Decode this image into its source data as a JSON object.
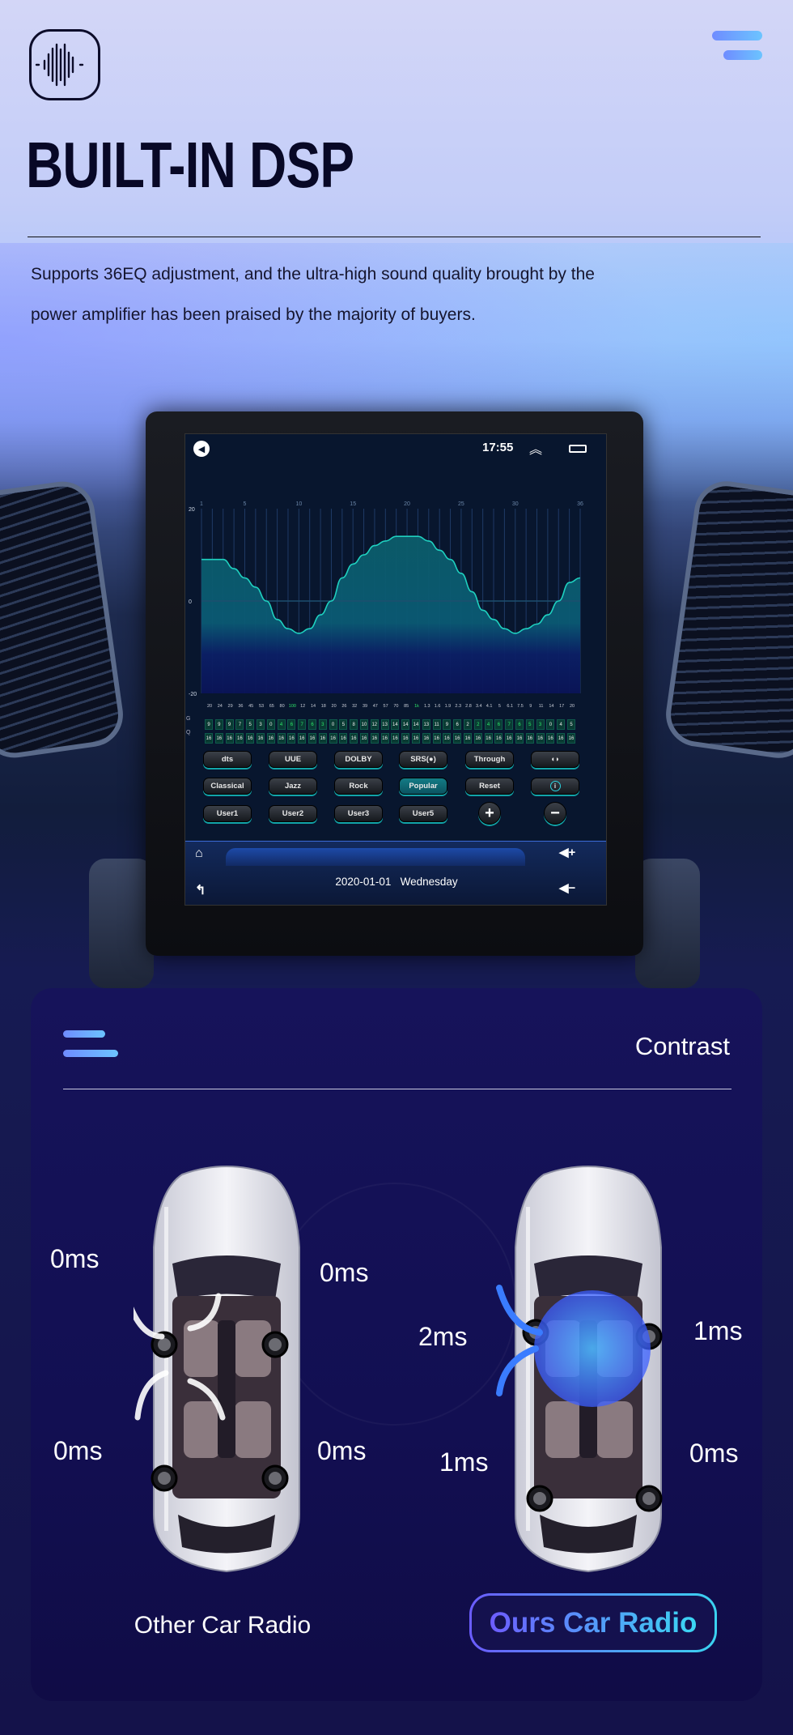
{
  "header": {
    "logo_icon": "sound-wave-icon",
    "menu_icon": "hamburger-menu-icon",
    "title": "BUILT-IN DSP",
    "description_lines": [
      "Supports 36EQ adjustment, and the ultra-high sound quality brought by the",
      "power amplifier has been praised by the majority of buyers."
    ]
  },
  "device": {
    "status_bar": {
      "time": "17:55",
      "left_icon": "speaker-icon",
      "icons": [
        "double-chevron-up-icon",
        "recent-apps-icon"
      ]
    },
    "eq": {
      "row_labels": {
        "gain": "G",
        "q": "Q"
      },
      "frequencies": [
        "20",
        "24",
        "29",
        "36",
        "45",
        "53",
        "65",
        "80",
        "100",
        "12",
        "14",
        "18",
        "20",
        "26",
        "32",
        "39",
        "47",
        "57",
        "70",
        "85",
        "1k",
        "1.3",
        "1.6",
        "1.9",
        "2.3",
        "2.8",
        "3.4",
        "4.1",
        "5",
        "6.1",
        "7.5",
        "9",
        "11",
        "14",
        "17",
        "20"
      ],
      "highlight_frequencies": [
        "100",
        "1k"
      ],
      "q_values": [
        "16",
        "16",
        "16",
        "16",
        "16",
        "16",
        "16",
        "16",
        "16",
        "16",
        "16",
        "16",
        "16",
        "16",
        "16",
        "16",
        "16",
        "16",
        "16",
        "16",
        "16",
        "16",
        "16",
        "16",
        "16",
        "16",
        "16",
        "16",
        "16",
        "16",
        "16",
        "16",
        "16",
        "16",
        "16",
        "16"
      ],
      "colors": {
        "curve": "#1fd1c0",
        "negative_gain": "#2ee86a",
        "button_glow": "#12a4a8"
      }
    },
    "buttons": [
      [
        {
          "label": "dts"
        },
        {
          "label": "UUE"
        },
        {
          "label": "DOLBY"
        },
        {
          "label": "SRS(●)"
        },
        {
          "label": "Through"
        },
        {
          "label": "◖◗",
          "icon": "speaker-balance-icon"
        }
      ],
      [
        {
          "label": "Classical"
        },
        {
          "label": "Jazz"
        },
        {
          "label": "Rock"
        },
        {
          "label": "Popular",
          "active": true
        },
        {
          "label": "Reset"
        },
        {
          "label": "i",
          "icon": "info-icon"
        }
      ],
      [
        {
          "label": "User1"
        },
        {
          "label": "User2"
        },
        {
          "label": "User3"
        },
        {
          "label": "User5"
        },
        {
          "label": "+",
          "icon": "plus-icon"
        },
        {
          "label": "−",
          "icon": "minus-icon"
        }
      ]
    ],
    "bottom_bar": {
      "date": "2020-01-01",
      "weekday": "Wednesday",
      "icons": [
        "home-icon",
        "back-icon",
        "volume-up-icon",
        "volume-down-icon"
      ]
    }
  },
  "chart_data": {
    "type": "area",
    "x": [
      1,
      2,
      3,
      4,
      5,
      6,
      7,
      8,
      9,
      10,
      11,
      12,
      13,
      14,
      15,
      16,
      17,
      18,
      19,
      20,
      21,
      22,
      23,
      24,
      25,
      26,
      27,
      28,
      29,
      30,
      31,
      32,
      33,
      34,
      35,
      36
    ],
    "x_ticks": [
      "1",
      "5",
      "10",
      "15",
      "20",
      "25",
      "30",
      "36"
    ],
    "y_ticks": [
      "20",
      "0",
      "-20"
    ],
    "ylim": [
      -20,
      20
    ],
    "values": [
      9,
      9,
      9,
      7,
      5,
      3,
      0,
      -4,
      -6,
      -7,
      -6,
      -3,
      0,
      5,
      8,
      10,
      12,
      13,
      14,
      14,
      14,
      13,
      11,
      9,
      6,
      2,
      -2,
      -4,
      -6,
      -7,
      -6,
      -5,
      -3,
      0,
      4,
      5
    ],
    "grid": true
  },
  "contrast": {
    "menu_icon": "hamburger-menu-icon",
    "title": "Contrast",
    "other": {
      "label": "Other Car Radio",
      "delays": {
        "front_left": "0ms",
        "front_right": "0ms",
        "rear_left": "0ms",
        "rear_right": "0ms"
      }
    },
    "ours": {
      "label": "Ours Car Radio",
      "delays": {
        "front_left": "2ms",
        "front_right": "1ms",
        "rear_left": "1ms",
        "rear_right": "0ms"
      }
    }
  }
}
